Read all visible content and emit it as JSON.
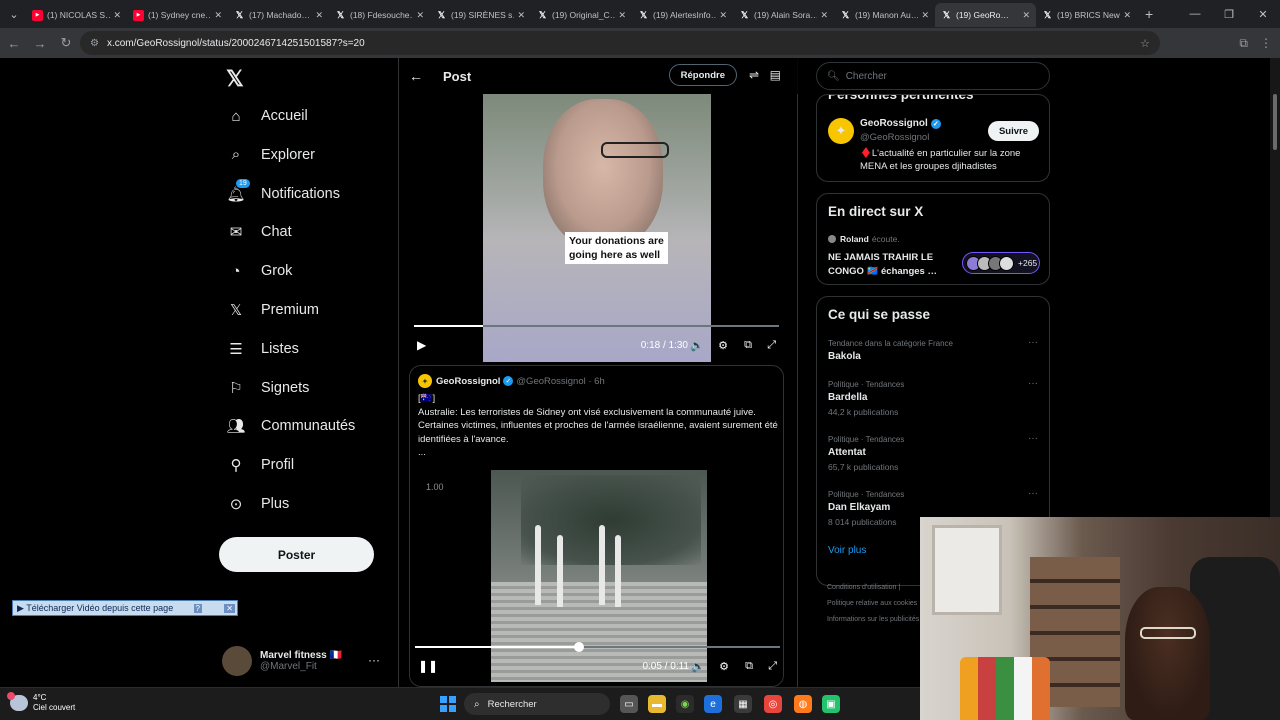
{
  "browser": {
    "tabs": [
      {
        "label": "(1) NICOLAS S…",
        "favicon": "youtube-icon"
      },
      {
        "label": "(1) Sydney cne…",
        "favicon": "youtube-icon"
      },
      {
        "label": "(17) Machado…",
        "favicon": "x-icon"
      },
      {
        "label": "(18) Fdesouche…",
        "favicon": "x-icon"
      },
      {
        "label": "(19) SIRÈNES s…",
        "favicon": "x-icon"
      },
      {
        "label": "(19) Original_C…",
        "favicon": "x-icon"
      },
      {
        "label": "(19) AlertesInfo…",
        "favicon": "x-icon"
      },
      {
        "label": "(19) Alain Sora…",
        "favicon": "x-icon"
      },
      {
        "label": "(19) Manon Au…",
        "favicon": "x-icon"
      },
      {
        "label": "(19) GeoRo…",
        "favicon": "x-icon",
        "active": true
      },
      {
        "label": "(19) BRICS New…",
        "favicon": "x-icon"
      }
    ],
    "url": "x.com/GeoRossignol/status/2000246714251501587?s=20"
  },
  "left_nav": {
    "items": [
      {
        "label": "Accueil",
        "icon": "home-icon"
      },
      {
        "label": "Explorer",
        "icon": "search-icon"
      },
      {
        "label": "Notifications",
        "icon": "bell-icon",
        "badge": "19"
      },
      {
        "label": "Chat",
        "icon": "mail-icon"
      },
      {
        "label": "Grok",
        "icon": "grok-icon"
      },
      {
        "label": "Premium",
        "icon": "x-icon"
      },
      {
        "label": "Listes",
        "icon": "list-icon"
      },
      {
        "label": "Signets",
        "icon": "bookmark-icon"
      },
      {
        "label": "Communautés",
        "icon": "people-icon"
      },
      {
        "label": "Profil",
        "icon": "person-icon"
      },
      {
        "label": "Plus",
        "icon": "more-circle-icon"
      }
    ],
    "post_button": "Poster",
    "account": {
      "name": "Marvel fitness 🇫🇷",
      "handle": "@Marvel_Fit"
    },
    "download_banner": "▶ Télécharger Vidéo depuis cette page"
  },
  "main": {
    "header_title": "Post",
    "reply_button": "Répondre",
    "video1": {
      "caption_line1": "Your donations are",
      "caption_line2": "going here as well",
      "time": "0:18 / 1:30",
      "progress": 0.19
    },
    "quote": {
      "author": "GeoRossignol",
      "handle_time": "@GeoRossignol · 6h",
      "flag_line": "[🇦🇺]",
      "text": "Australie: Les terroristes de Sidney ont visé exclusivement la communauté juive. Certaines victimes, influentes et proches de l'armée israélienne, avaient surement été identifiées à l'avance.",
      "ellipsis": "...",
      "video": {
        "zoom_label": "1.00",
        "time": "0:05 / 0:11",
        "progress": 0.45
      }
    }
  },
  "right": {
    "search_placeholder": "Chercher",
    "relevant": {
      "title": "Personnes pertinentes",
      "name": "GeoRossignol",
      "handle": "@GeoRossignol",
      "bio": "♦️L'actualité en particulier sur la zone MENA et les groupes djihadistes",
      "follow": "Suivre"
    },
    "live": {
      "title": "En direct sur X",
      "host": "Roland",
      "status": "écoute.",
      "stream_title": "NE JAMAIS TRAHIR LE CONGO 🇨🇩 échanges …",
      "listeners": "+265"
    },
    "trends": {
      "title": "Ce qui se passe",
      "items": [
        {
          "category": "Tendance dans la catégorie France",
          "name": "Bakola",
          "count": ""
        },
        {
          "category": "Politique · Tendances",
          "name": "Bardella",
          "count": "44,2 k publications"
        },
        {
          "category": "Politique · Tendances",
          "name": "Attentat",
          "count": "65,7 k publications"
        },
        {
          "category": "Politique · Tendances",
          "name": "Dan Elkayam",
          "count": "8 014 publications"
        }
      ],
      "more": "Voir plus"
    },
    "footer": [
      "Conditions d'utilisation  |",
      "Politique relative aux cookies",
      "Informations sur les publicités"
    ]
  },
  "taskbar": {
    "temperature": "4°C",
    "weather": "Ciel couvert",
    "search": "Rechercher"
  }
}
